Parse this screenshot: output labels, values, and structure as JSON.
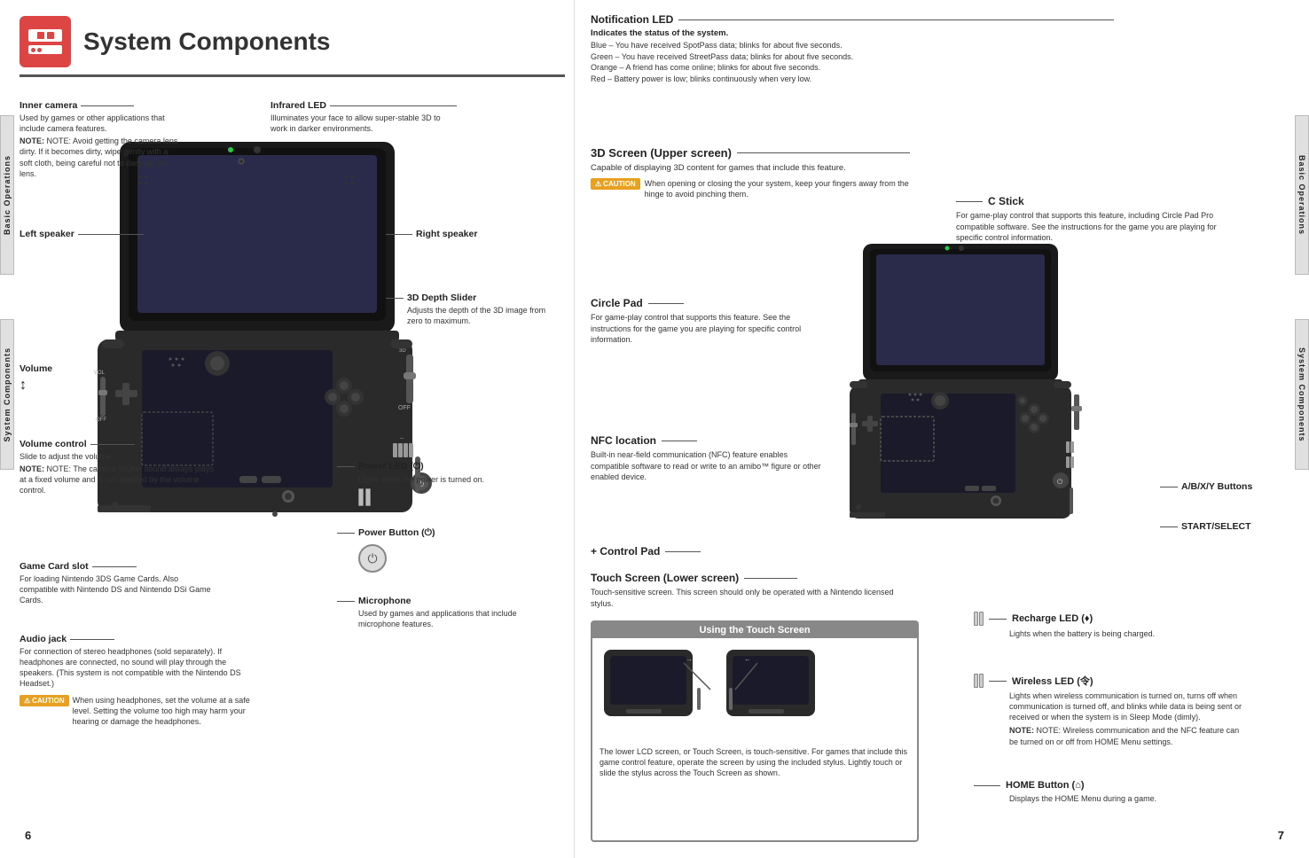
{
  "page": {
    "left_number": "6",
    "right_number": "7"
  },
  "header": {
    "title": "System Components",
    "icon_label": "system-icon"
  },
  "side_tabs": {
    "left_top": "Basic Operations",
    "left_bottom": "System Components",
    "right_top": "Basic Operations",
    "right_bottom": "System Components"
  },
  "notification_led": {
    "title": "Notification LED",
    "subtitle": "Indicates the status of the system.",
    "lines": [
      "Blue – You have received SpotPass data; blinks for about five seconds.",
      "Green – You have received StreetPass data; blinks for about five seconds.",
      "Orange – A friend has come online; blinks for about five seconds.",
      "Red – Battery power is low; blinks continuously when very low."
    ]
  },
  "screen3d": {
    "title": "3D Screen (Upper screen)",
    "body": "Capable of displaying 3D content for games that include this feature.",
    "caution_label": "CAUTION",
    "caution_text": "When opening or closing the your system, keep your fingers away from the hinge to avoid pinching them."
  },
  "cstick": {
    "title": "C Stick",
    "body": "For game-play control that supports this feature, including Circle Pad Pro compatible software. See the instructions for the game you are playing for specific control information."
  },
  "circle_pad": {
    "title": "Circle Pad",
    "body": "For game-play control that supports this feature. See the instructions for the game you are playing for specific control information."
  },
  "nfc": {
    "title": "NFC location",
    "body": "Built-in near-field communication (NFC) feature enables compatible software to read or write to an amibo™ figure or other enabled device."
  },
  "control_pad": {
    "title": "+ Control Pad"
  },
  "touch_screen": {
    "title": "Touch Screen (Lower screen)",
    "body": "Touch-sensitive screen. This screen should only be operated with a Nintendo licensed stylus."
  },
  "using_touch_screen": {
    "title": "Using the Touch Screen",
    "body": "The lower LCD screen, or Touch Screen, is touch-sensitive. For games that include this game control feature, operate the screen by using the included stylus. Lightly touch or slide the stylus across the Touch Screen as shown."
  },
  "abxy": {
    "title": "A/B/X/Y Buttons"
  },
  "start_select": {
    "title": "START/SELECT"
  },
  "recharge_led": {
    "title": "Recharge LED (♦)",
    "body": "Lights when the battery is being charged."
  },
  "wireless_led": {
    "title": "Wireless LED (令)",
    "body": "Lights when wireless communication is turned on, turns off when communication is turned off, and blinks while data is being sent or received or when the system is in Sleep Mode (dimly).",
    "note": "NOTE: Wireless communication and the NFC feature can be turned on or off from HOME Menu settings."
  },
  "home_button": {
    "title": "HOME Button (⌂)",
    "body": "Displays the HOME Menu during a game."
  },
  "labels": {
    "inner_camera": {
      "title": "Inner camera",
      "body": "Used by games or other applications that include camera features.",
      "note": "NOTE: Avoid getting the camera lens dirty. If it becomes dirty, wipe gently with a soft cloth, being careful not to damage the lens."
    },
    "infrared_led": {
      "title": "Infrared LED",
      "body": "Illuminates your face to allow super-stable 3D to work in darker environments."
    },
    "left_speaker": {
      "title": "Left speaker"
    },
    "right_speaker": {
      "title": "Right speaker"
    },
    "depth_slider": {
      "title": "3D Depth Slider",
      "body": "Adjusts the depth of the 3D image from zero to maximum."
    },
    "volume": {
      "title": "Volume"
    },
    "volume_control": {
      "title": "Volume control",
      "body": "Slide to adjust the volume.",
      "note": "NOTE: The camera shutter sound always plays at a fixed volume and is not affected by the volume control."
    },
    "game_card_slot": {
      "title": "Game Card slot",
      "body": "For loading Nintendo 3DS Game Cards. Also compatible with Nintendo DS and Nintendo DSi Game Cards."
    },
    "audio_jack": {
      "title": "Audio jack",
      "body": "For connection of stereo headphones (sold separately). If headphones are connected, no sound will play through the speakers. (This system is not compatible with the Nintendo DS Headset.)",
      "caution_label": "CAUTION",
      "caution_text": "When using headphones, set the volume at a safe level. Setting the volume too high may harm your hearing or damage the headphones."
    },
    "microphone": {
      "title": "Microphone",
      "body": "Used by games and applications that include microphone features."
    },
    "power_led": {
      "title": "Power LED (⏻)",
      "body": "Lights when the power is turned on."
    },
    "power_button": {
      "title": "Power Button (⏻)"
    }
  }
}
